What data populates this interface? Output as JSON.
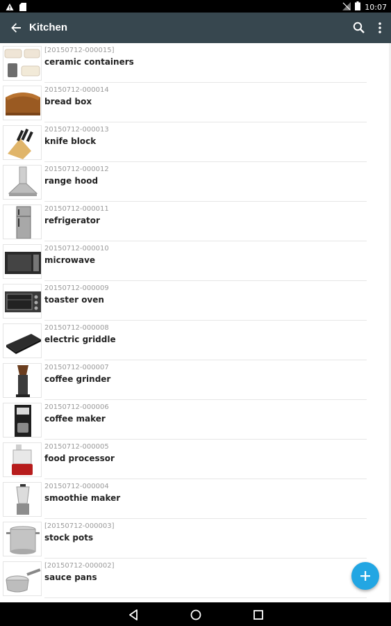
{
  "status_bar": {
    "time": "10:07",
    "left_icons": [
      "warning-icon",
      "sd-card-icon"
    ],
    "right_icons": [
      "no-signal-icon",
      "battery-icon"
    ]
  },
  "app_bar": {
    "title": "Kitchen",
    "background": "#37474f",
    "actions": [
      "search-icon",
      "more-vert-icon"
    ]
  },
  "items": [
    {
      "code": "[20150712-000015]",
      "name": "ceramic containers",
      "icon": "ceramic-containers-thumbnail"
    },
    {
      "code": "20150712-000014",
      "name": "bread box",
      "icon": "bread-box-thumbnail"
    },
    {
      "code": "20150712-000013",
      "name": "knife block",
      "icon": "knife-block-thumbnail"
    },
    {
      "code": "20150712-000012",
      "name": "range hood",
      "icon": "range-hood-thumbnail"
    },
    {
      "code": "20150712-000011",
      "name": "refrigerator",
      "icon": "refrigerator-thumbnail"
    },
    {
      "code": "20150712-000010",
      "name": "microwave",
      "icon": "microwave-thumbnail"
    },
    {
      "code": "20150712-000009",
      "name": "toaster oven",
      "icon": "toaster-oven-thumbnail"
    },
    {
      "code": "20150712-000008",
      "name": "electric griddle",
      "icon": "electric-griddle-thumbnail"
    },
    {
      "code": "20150712-000007",
      "name": "coffee grinder",
      "icon": "coffee-grinder-thumbnail"
    },
    {
      "code": "20150712-000006",
      "name": "coffee maker",
      "icon": "coffee-maker-thumbnail"
    },
    {
      "code": "20150712-000005",
      "name": "food processor",
      "icon": "food-processor-thumbnail"
    },
    {
      "code": "20150712-000004",
      "name": "smoothie maker",
      "icon": "smoothie-maker-thumbnail"
    },
    {
      "code": "[20150712-000003]",
      "name": "stock pots",
      "icon": "stock-pot-thumbnail"
    },
    {
      "code": "[20150712-000002]",
      "name": "sauce pans",
      "icon": "sauce-pan-thumbnail"
    }
  ],
  "fab": {
    "icon": "plus-icon",
    "color": "#22a6e3"
  },
  "nav_bar": {
    "buttons": [
      "back-triangle-icon",
      "home-circle-icon",
      "recents-square-icon"
    ]
  }
}
